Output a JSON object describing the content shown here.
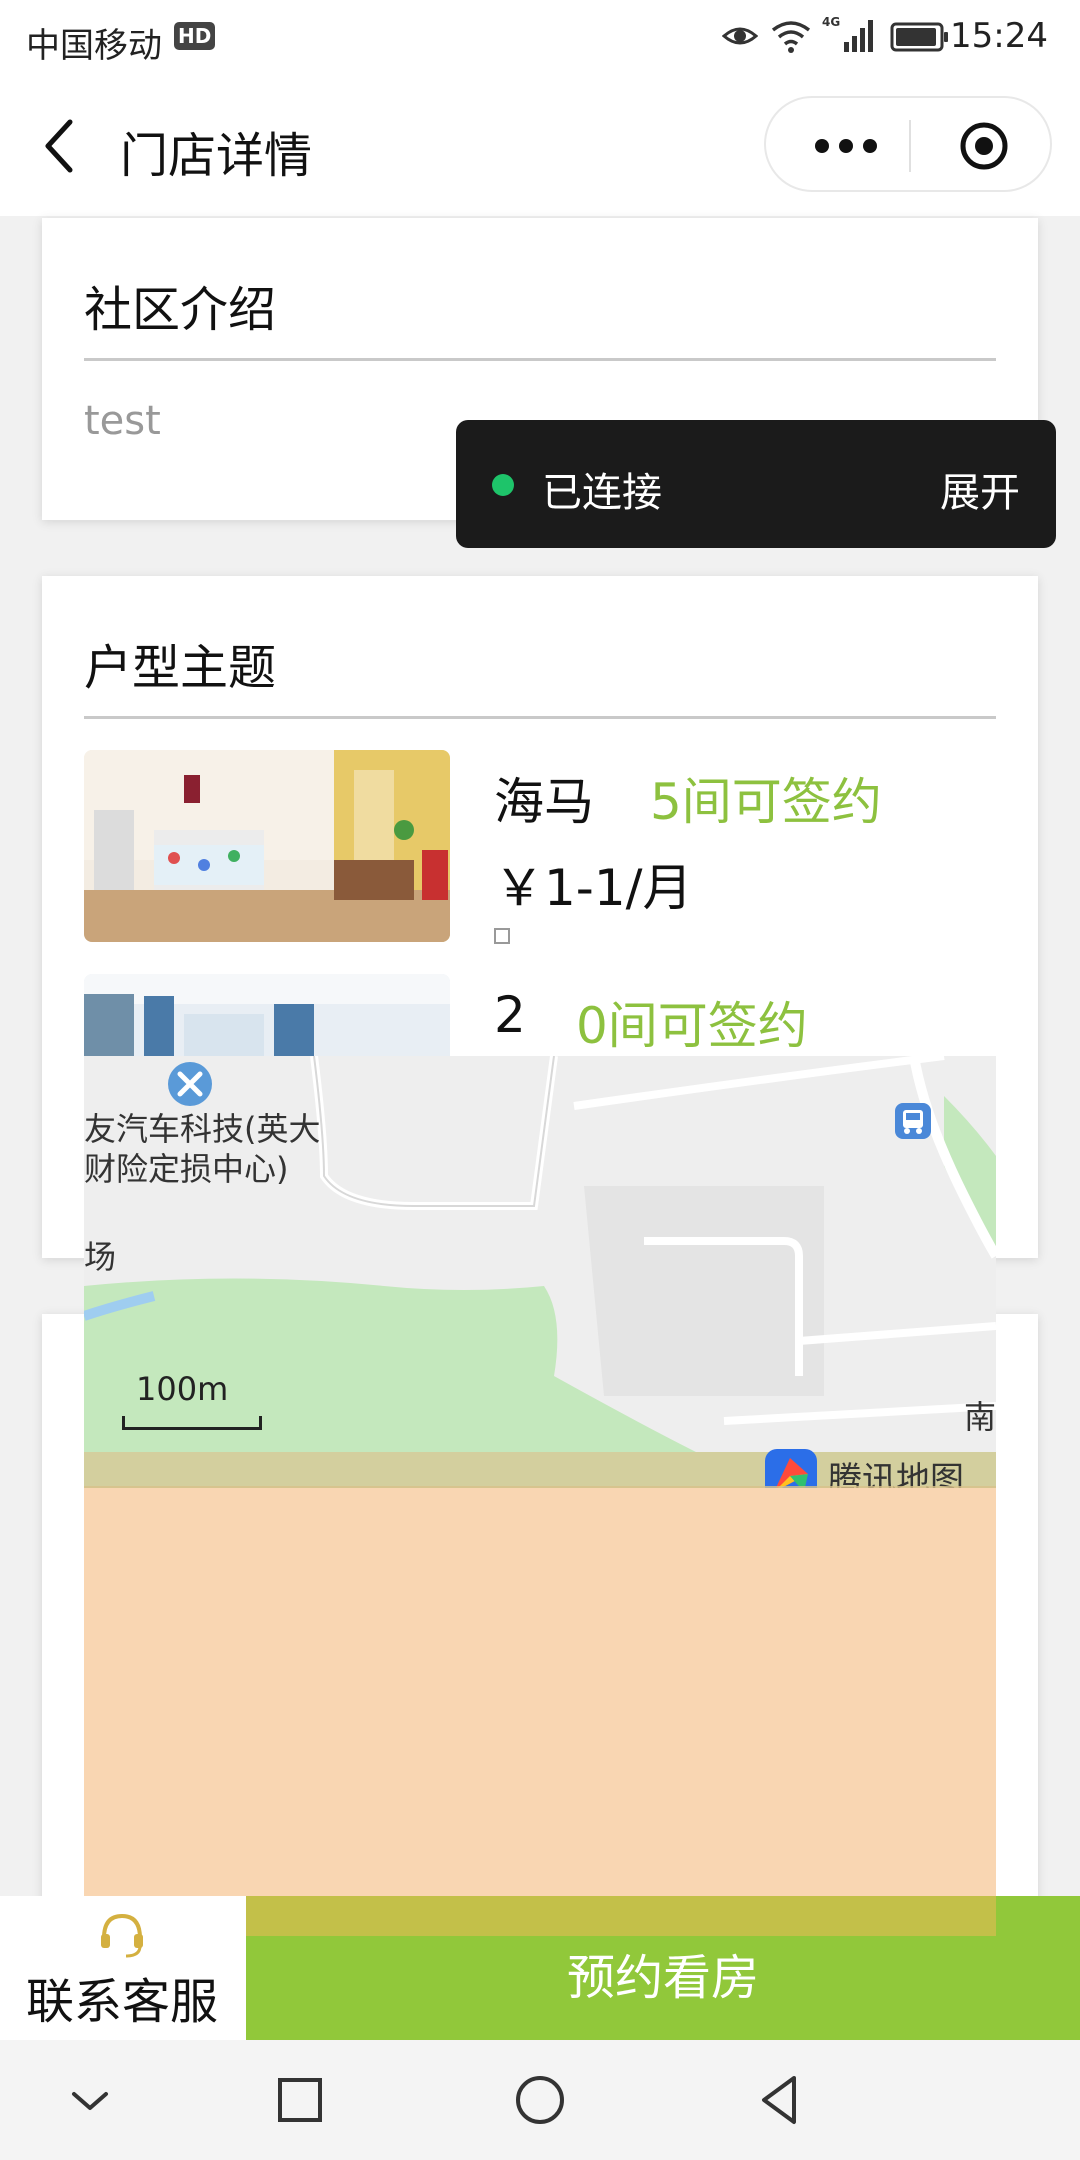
{
  "status_bar": {
    "carrier": "中国移动",
    "hd_badge": "HD",
    "network": "4G",
    "time": "15:24"
  },
  "navbar": {
    "title": "门店详情",
    "more_icon": "more-icon",
    "close_icon": "target-close-icon"
  },
  "intro_card": {
    "title": "社区介绍",
    "text": "test"
  },
  "toast": {
    "status": "已连接",
    "action": "展开",
    "dot_color": "#1ec46a"
  },
  "types_card": {
    "title": "户型主题",
    "rooms": [
      {
        "name": "海马",
        "available": "5间可签约",
        "price": "￥1-1/月"
      },
      {
        "name": "2",
        "available": "0间可签约"
      }
    ]
  },
  "map": {
    "poi_line1": "友汽车科技(英大",
    "poi_line2": "财险定损中心)",
    "edge_label_left": "场",
    "edge_label_right": "南",
    "scale": "100m",
    "provider": "腾讯地图"
  },
  "bottom_bar": {
    "service_label": "联系客服",
    "book_label": "预约看房",
    "accent": "#91c83a"
  },
  "colors": {
    "available_green": "#8dc13f",
    "map_green": "#c4e8bd",
    "overlay_peach": "#f9d6b2"
  }
}
